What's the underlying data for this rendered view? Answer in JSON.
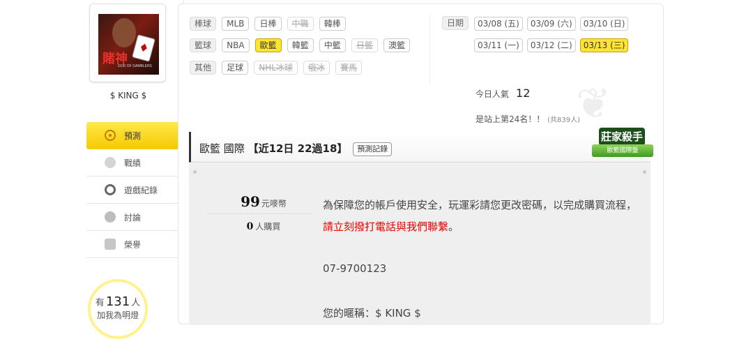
{
  "user": {
    "name": "$ KING $"
  },
  "nav": [
    {
      "label": "預測",
      "active": true
    },
    {
      "label": "戰績"
    },
    {
      "label": "遊戲紀錄"
    },
    {
      "label": "討論"
    },
    {
      "label": "榮譽"
    }
  ],
  "fans": {
    "prefix": "有",
    "count": "131",
    "suffix": "人",
    "caption": "加我為明燈"
  },
  "filters": {
    "baseball": {
      "label": "棒球",
      "items": [
        "MLB",
        "日棒",
        "中職",
        "韓棒"
      ]
    },
    "basketball": {
      "label": "籃球",
      "items": [
        "NBA",
        "歐籃",
        "韓籃",
        "中籃",
        "日籃",
        "澳籃"
      ]
    },
    "other": {
      "label": "其他",
      "items": [
        "足球",
        "NHL冰球",
        "俄冰",
        "賽馬"
      ]
    }
  },
  "dates": {
    "label": "日期",
    "items": [
      "03/08 (五)",
      "03/09 (六)",
      "03/10 (日)",
      "03/11 (一)",
      "03/12 (二)",
      "03/13 (三)"
    ]
  },
  "stats": {
    "today_label": "今日人氣",
    "today_value": "12",
    "rank_text": "是站上第24名！！",
    "rank_total": "(共839人)"
  },
  "title": {
    "league": "歐籃 國際",
    "record": "【近12日 22過18】",
    "history_button": "預測記錄"
  },
  "badge": {
    "title": "莊家殺手",
    "sub": "歐籃國際盤"
  },
  "price": {
    "value": "99",
    "unit": "元嘜幣"
  },
  "buyers": {
    "value": "0",
    "unit": "人購買"
  },
  "message": {
    "text1": "為保障您的帳戶使用安全，玩運彩請您更改密碼，以完成購買流程，",
    "red": "請立刻撥打電話與我們聯繫",
    "end": "。",
    "phone": "07-9700123",
    "nick_label": "您的暱稱：",
    "nick_value": "$ KING $"
  }
}
